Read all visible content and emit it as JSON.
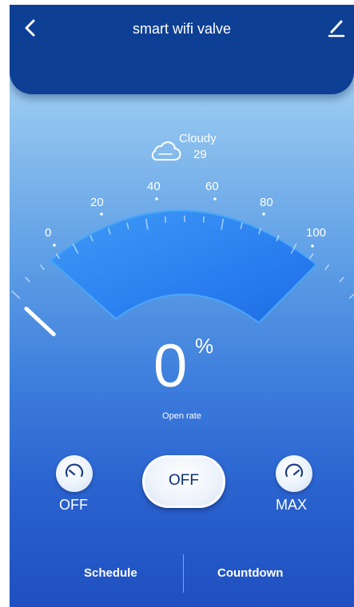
{
  "header": {
    "title": "smart wifi valve",
    "back_icon": "chevron-left-icon",
    "edit_icon": "pencil-icon"
  },
  "weather": {
    "icon": "cloud-icon",
    "condition": "Cloudy",
    "temperature": "29"
  },
  "gauge": {
    "min": 0,
    "max": 100,
    "tick_labels": [
      "0",
      "20",
      "40",
      "60",
      "80",
      "100"
    ],
    "current_value": 0
  },
  "reading": {
    "value": "0",
    "unit": "%",
    "label": "Open rate"
  },
  "controls": {
    "off_label": "OFF",
    "power_label": "OFF",
    "max_label": "MAX",
    "dial_icon": "gauge-icon"
  },
  "tabs": {
    "schedule": "Schedule",
    "countdown": "Countdown"
  },
  "colors": {
    "header": "#0d3f94",
    "gauge_fill": "#2f86f2",
    "power_text": "#0d2f7a"
  }
}
